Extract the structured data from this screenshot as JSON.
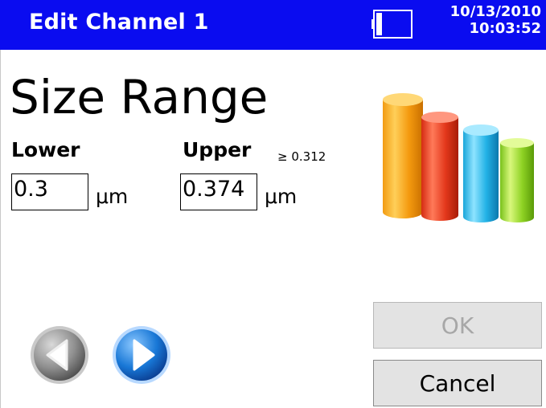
{
  "header": {
    "title": "Edit Channel 1",
    "date": "10/13/2010",
    "time": "10:03:52",
    "battery_icon": "battery-icon",
    "background_color": "#0a0cf0"
  },
  "main": {
    "heading": "Size Range",
    "lower": {
      "label": "Lower",
      "value": "0.3",
      "unit": "μm"
    },
    "upper": {
      "label": "Upper",
      "hint": "≥ 0.312",
      "value": "0.374",
      "unit": "μm"
    },
    "graphic_icon": "bar-chart-icon"
  },
  "buttons": {
    "ok_label": "OK",
    "ok_enabled": false,
    "cancel_label": "Cancel"
  },
  "navigation": {
    "previous_icon": "arrow-left-circle-icon",
    "previous_enabled": false,
    "next_icon": "arrow-right-circle-icon",
    "next_enabled": true
  }
}
